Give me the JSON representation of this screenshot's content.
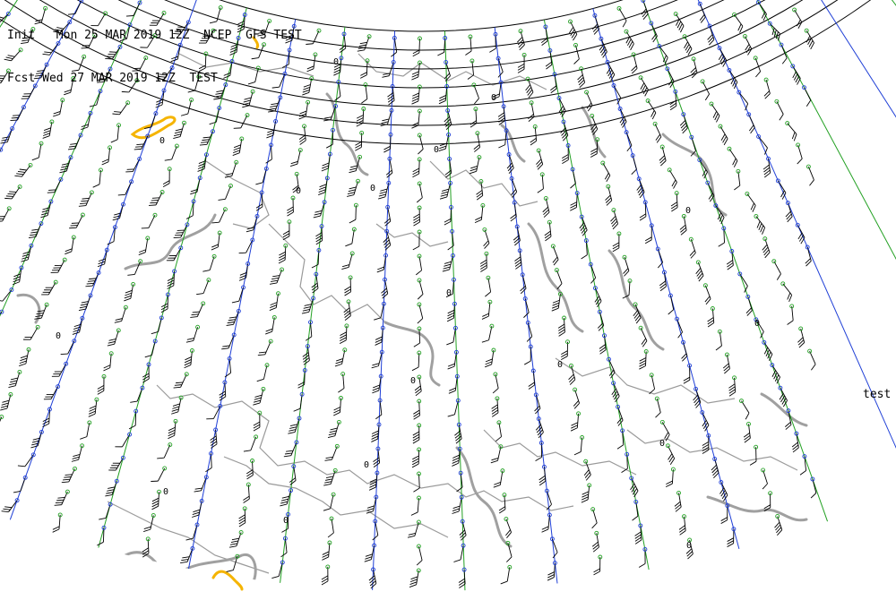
{
  "header": {
    "init_line": "Init   Mon 25 MAR 2019 12Z  NCEP  GFS TEST",
    "fcst_line": "Fcst Wed 27 MAR 2019 12Z  TEST"
  },
  "side_label": "test",
  "contour_value_label": "0",
  "colors": {
    "background": "#ffffff",
    "coastline": "#999999",
    "contour": "#999999",
    "highlight_contour": "#f5b400",
    "grid": "#000000",
    "meridian_blue": "#1f3fd6",
    "meridian_green": "#22a022",
    "barb": "#000000"
  },
  "layers": [
    "wind-barbs",
    "latitude-circles",
    "meridians",
    "coastlines",
    "contours"
  ]
}
